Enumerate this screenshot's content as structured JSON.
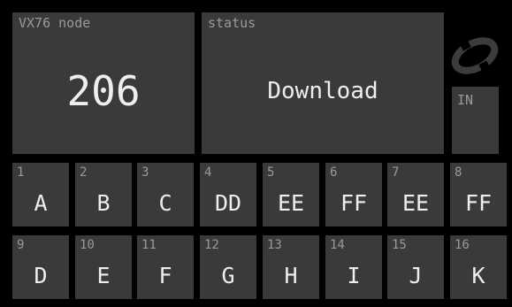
{
  "node": {
    "caption": "VX76 node",
    "value": "206"
  },
  "status": {
    "caption": "status",
    "value": "Download"
  },
  "logo_icon": "swirl-logo-icon",
  "io_indicator": {
    "label": "IN"
  },
  "pads": [
    {
      "number": "1",
      "letter": "A"
    },
    {
      "number": "2",
      "letter": "B"
    },
    {
      "number": "3",
      "letter": "C"
    },
    {
      "number": "4",
      "letter": "DD"
    },
    {
      "number": "5",
      "letter": "EE"
    },
    {
      "number": "6",
      "letter": "FF"
    },
    {
      "number": "7",
      "letter": "EE"
    },
    {
      "number": "8",
      "letter": "FF"
    },
    {
      "number": "9",
      "letter": "D"
    },
    {
      "number": "10",
      "letter": "E"
    },
    {
      "number": "11",
      "letter": "F"
    },
    {
      "number": "12",
      "letter": "G"
    },
    {
      "number": "13",
      "letter": "H"
    },
    {
      "number": "14",
      "letter": "I"
    },
    {
      "number": "15",
      "letter": "J"
    },
    {
      "number": "16",
      "letter": "K"
    }
  ],
  "colors": {
    "background": "#000000",
    "tile": "#3a3a3a",
    "caption_text": "#9a9a9a",
    "value_text": "#eeeeee"
  }
}
